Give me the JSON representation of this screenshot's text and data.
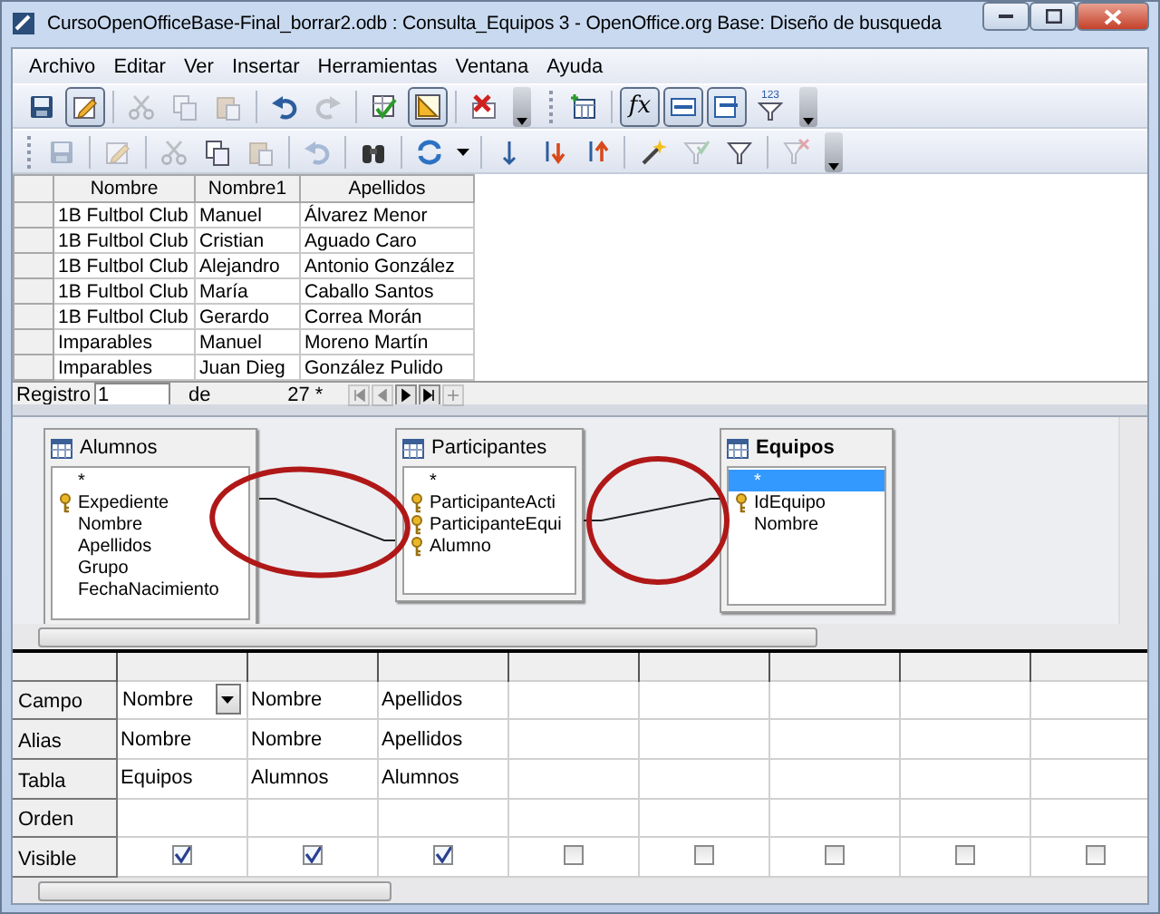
{
  "window": {
    "title": "CursoOpenOfficeBase-Final_borrar2.odb : Consulta_Equipos 3 - OpenOffice.org Base: Diseño de busqueda"
  },
  "menu": [
    "Archivo",
    "Editar",
    "Ver",
    "Insertar",
    "Herramientas",
    "Ventana",
    "Ayuda"
  ],
  "toolbars": [
    {
      "buttons": [
        {
          "kind": "save",
          "disabled": false,
          "pressed": false
        },
        {
          "kind": "edit",
          "disabled": false,
          "pressed": true
        },
        {
          "kind": "sep"
        },
        {
          "kind": "cut",
          "disabled": true,
          "pressed": false
        },
        {
          "kind": "copy",
          "disabled": true,
          "pressed": false
        },
        {
          "kind": "paste",
          "disabled": true,
          "pressed": false
        },
        {
          "kind": "sep"
        },
        {
          "kind": "undo",
          "disabled": false,
          "pressed": false
        },
        {
          "kind": "redo",
          "disabled": true,
          "pressed": false
        },
        {
          "kind": "sep"
        },
        {
          "kind": "run",
          "disabled": false,
          "pressed": false
        },
        {
          "kind": "design",
          "disabled": false,
          "pressed": true
        },
        {
          "kind": "sep"
        },
        {
          "kind": "clear",
          "disabled": false,
          "pressed": false
        },
        {
          "kind": "more"
        },
        {
          "kind": "grip"
        },
        {
          "kind": "addtable",
          "disabled": false,
          "pressed": false
        },
        {
          "kind": "sep"
        },
        {
          "kind": "fx",
          "label": "fx",
          "disabled": false,
          "pressed": true
        },
        {
          "kind": "alias",
          "disabled": false,
          "pressed": true
        },
        {
          "kind": "tablename",
          "disabled": false,
          "pressed": true
        },
        {
          "kind": "distinct",
          "label": "123",
          "disabled": false,
          "pressed": false
        },
        {
          "kind": "more"
        }
      ]
    },
    {
      "buttons": [
        {
          "kind": "grip"
        },
        {
          "kind": "save",
          "disabled": true,
          "pressed": false
        },
        {
          "kind": "sep"
        },
        {
          "kind": "edit",
          "disabled": true,
          "pressed": false
        },
        {
          "kind": "sep"
        },
        {
          "kind": "cut",
          "disabled": true,
          "pressed": false
        },
        {
          "kind": "copy",
          "disabled": false,
          "pressed": false
        },
        {
          "kind": "paste",
          "disabled": true,
          "pressed": false
        },
        {
          "kind": "sep"
        },
        {
          "kind": "undo",
          "disabled": true,
          "pressed": false
        },
        {
          "kind": "sep"
        },
        {
          "kind": "find",
          "disabled": false,
          "pressed": false
        },
        {
          "kind": "sep"
        },
        {
          "kind": "refresh",
          "disabled": false,
          "pressed": false
        },
        {
          "kind": "caret"
        },
        {
          "kind": "sep"
        },
        {
          "kind": "sortaz",
          "disabled": false,
          "pressed": false
        },
        {
          "kind": "sortup",
          "disabled": false,
          "pressed": false
        },
        {
          "kind": "sortdown",
          "disabled": false,
          "pressed": false
        },
        {
          "kind": "sep"
        },
        {
          "kind": "wand",
          "disabled": false,
          "pressed": false
        },
        {
          "kind": "stdfilter",
          "disabled": true,
          "pressed": false
        },
        {
          "kind": "filter",
          "disabled": false,
          "pressed": false
        },
        {
          "kind": "sep"
        },
        {
          "kind": "nofilter",
          "disabled": true,
          "pressed": false
        },
        {
          "kind": "more"
        }
      ]
    }
  ],
  "results": {
    "columns": [
      "Nombre",
      "Nombre1",
      "Apellidos"
    ],
    "rows": [
      [
        "1B Fultbol Club",
        "Manuel",
        "Álvarez Menor"
      ],
      [
        "1B Fultbol Club",
        "Cristian",
        "Aguado Caro"
      ],
      [
        "1B Fultbol Club",
        "Alejandro",
        "Antonio González"
      ],
      [
        "1B Fultbol Club",
        "María",
        "Caballo Santos"
      ],
      [
        "1B Fultbol Club",
        "Gerardo",
        "Correa Morán"
      ],
      [
        "Imparables",
        "Manuel",
        "Moreno Martín"
      ],
      [
        "Imparables",
        "Juan Dieg",
        "González Pulido"
      ]
    ]
  },
  "navigation": {
    "label": "Registro",
    "value": "1",
    "of": "de",
    "total": "27 *",
    "buttons": [
      {
        "kind": "first",
        "disabled": true
      },
      {
        "kind": "prev",
        "disabled": true
      },
      {
        "kind": "next",
        "disabled": false
      },
      {
        "kind": "last",
        "disabled": false
      },
      {
        "kind": "new",
        "disabled": true
      }
    ]
  },
  "tables": [
    {
      "name": "Alumnos",
      "focused": false,
      "fields": [
        {
          "name": "*",
          "key": false,
          "selected": false
        },
        {
          "name": "Expediente",
          "key": true,
          "selected": false
        },
        {
          "name": "Nombre",
          "key": false,
          "selected": false
        },
        {
          "name": "Apellidos",
          "key": false,
          "selected": false
        },
        {
          "name": "Grupo",
          "key": false,
          "selected": false
        },
        {
          "name": "FechaNacimiento",
          "key": false,
          "selected": false
        }
      ]
    },
    {
      "name": "Participantes",
      "focused": false,
      "fields": [
        {
          "name": "*",
          "key": false,
          "selected": false
        },
        {
          "name": "ParticipanteActi",
          "key": true,
          "selected": false
        },
        {
          "name": "ParticipanteEqui",
          "key": true,
          "selected": false
        },
        {
          "name": "Alumno",
          "key": true,
          "selected": false
        }
      ]
    },
    {
      "name": "Equipos",
      "focused": true,
      "fields": [
        {
          "name": "*",
          "key": false,
          "selected": true
        },
        {
          "name": "IdEquipo",
          "key": true,
          "selected": false
        },
        {
          "name": "Nombre",
          "key": false,
          "selected": false
        }
      ]
    }
  ],
  "design_grid": {
    "row_labels": [
      "Campo",
      "Alias",
      "Tabla",
      "Orden",
      "Visible"
    ],
    "columns": [
      {
        "field": "Nombre",
        "alias": "Nombre",
        "table": "Equipos",
        "visible": true,
        "editing": true
      },
      {
        "field": "Nombre",
        "alias": "Nombre",
        "table": "Alumnos",
        "visible": true,
        "editing": false
      },
      {
        "field": "Apellidos",
        "alias": "Apellidos",
        "table": "Alumnos",
        "visible": true,
        "editing": false
      },
      {
        "visible": false,
        "editing": false
      },
      {
        "visible": false,
        "editing": false
      },
      {
        "visible": false,
        "editing": false
      },
      {
        "visible": false,
        "editing": false
      },
      {
        "visible": false,
        "editing": false
      }
    ]
  }
}
